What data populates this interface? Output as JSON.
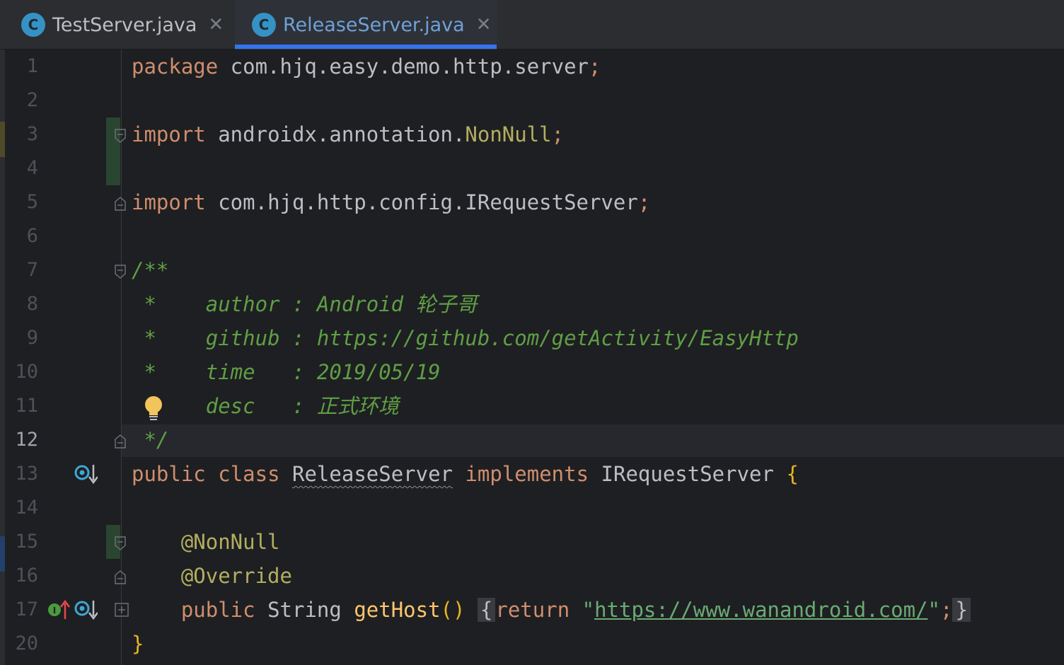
{
  "tabs": [
    {
      "label": "TestServer.java",
      "icon": "class-icon",
      "icon_letter": "C",
      "close": "✕",
      "active": false
    },
    {
      "label": "ReleaseServer.java",
      "icon": "class-icon",
      "icon_letter": "C",
      "close": "✕",
      "active": true
    }
  ],
  "gutter": {
    "line_numbers": [
      "1",
      "2",
      "3",
      "4",
      "5",
      "6",
      "7",
      "8",
      "9",
      "10",
      "11",
      "12",
      "13",
      "14",
      "15",
      "16",
      "17",
      "20"
    ],
    "current_line": "12"
  },
  "code": {
    "line1": {
      "kw": "package",
      "pkg": " com.hjq.easy.demo.http.server",
      "semi": ";"
    },
    "line3": {
      "kw": "import",
      "pkg": " androidx.annotation.",
      "cls": "NonNull",
      "semi": ";"
    },
    "line5": {
      "kw": "import",
      "pkg": " com.hjq.http.config.IRequestServer",
      "semi": ";"
    },
    "line7": {
      "text": "/**"
    },
    "line8": {
      "star": " *",
      "tag": "author",
      "sep": " : ",
      "val": "Android 轮子哥"
    },
    "line9": {
      "star": " *",
      "tag": "github",
      "sep": " : ",
      "val": "https://github.com/getActivity/EasyHttp"
    },
    "line10": {
      "star": " *",
      "tag": "time",
      "sep": "   : ",
      "val": "2019/05/19"
    },
    "line11": {
      "tag": "desc",
      "sep": "   : ",
      "val": "正式环境"
    },
    "line12": {
      "text": " */"
    },
    "line13": {
      "kw1": "public",
      "kw2": "class",
      "name": "ReleaseServer",
      "kw3": "implements",
      "iface": "IRequestServer",
      "brace": "{"
    },
    "line15": {
      "ann": "@NonNull"
    },
    "line16": {
      "ann": "@Override"
    },
    "line17": {
      "kw1": "public",
      "type": "String",
      "meth": "getHost",
      "parens": "()",
      "ob": "{",
      "kw2": "return",
      "q1": "\"",
      "url": "https://www.wanandroid.com/",
      "q2": "\"",
      "semi": ";",
      "cb": "}"
    },
    "line20": {
      "brace": "}"
    }
  },
  "colors": {
    "keyword": "#cf8e6d",
    "comment": "#5f9f45",
    "annotation": "#b3ae60",
    "method": "#56a8f5",
    "tab_accent": "#3574f0",
    "bulb": "#f2c55c"
  }
}
